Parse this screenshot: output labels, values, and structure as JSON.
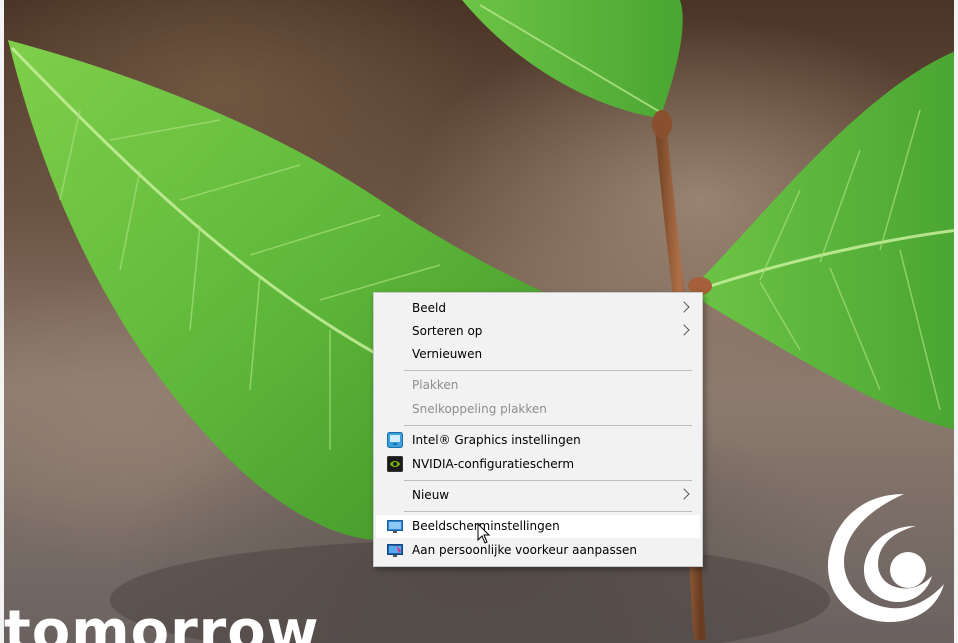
{
  "watermark": {
    "text": "tomorrow"
  },
  "context_menu": {
    "items": [
      {
        "label": "Beeld",
        "submenu": true,
        "enabled": true
      },
      {
        "label": "Sorteren op",
        "submenu": true,
        "enabled": true
      },
      {
        "label": "Vernieuwen",
        "submenu": false,
        "enabled": true
      },
      {
        "label": "Plakken",
        "submenu": false,
        "enabled": false
      },
      {
        "label": "Snelkoppeling plakken",
        "submenu": false,
        "enabled": false
      },
      {
        "label": "Intel® Graphics instellingen",
        "submenu": false,
        "enabled": true,
        "icon": "intel-graphics-icon"
      },
      {
        "label": "NVIDIA-configuratiescherm",
        "submenu": false,
        "enabled": true,
        "icon": "nvidia-icon"
      },
      {
        "label": "Nieuw",
        "submenu": true,
        "enabled": true
      },
      {
        "label": "Beeldscherminstellingen",
        "submenu": false,
        "enabled": true,
        "icon": "display-settings-icon",
        "hovered": true
      },
      {
        "label": "Aan persoonlijke voorkeur aanpassen",
        "submenu": false,
        "enabled": true,
        "icon": "personalize-icon"
      }
    ]
  },
  "colors": {
    "menu_background": "#f2f2f2",
    "menu_hover": "#ffffff",
    "disabled_text": "#8e8e8e",
    "leaf_green": "#5fb83a"
  }
}
